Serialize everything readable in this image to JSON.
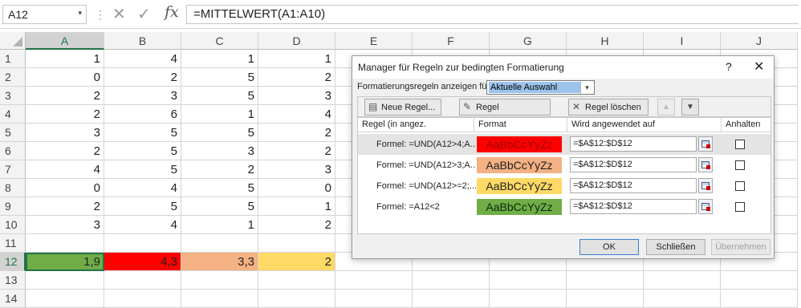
{
  "formula_bar": {
    "name_box": "A12",
    "name_box_dropdown": "▾",
    "separator": "⋮",
    "cancel_icon": "✕",
    "enter_icon": "✓",
    "fx": "fx",
    "formula": "=MITTELWERT(A1:A10)"
  },
  "sheet": {
    "columns": [
      "A",
      "B",
      "C",
      "D",
      "E",
      "F",
      "G",
      "H",
      "I",
      "J"
    ],
    "rows": [
      "1",
      "2",
      "3",
      "4",
      "5",
      "6",
      "7",
      "8",
      "9",
      "10",
      "11",
      "12",
      "13",
      "14"
    ],
    "data": [
      [
        "1",
        "4",
        "1",
        "1"
      ],
      [
        "0",
        "2",
        "5",
        "2"
      ],
      [
        "2",
        "3",
        "5",
        "3"
      ],
      [
        "2",
        "6",
        "1",
        "4"
      ],
      [
        "3",
        "5",
        "5",
        "2"
      ],
      [
        "2",
        "5",
        "3",
        "2"
      ],
      [
        "4",
        "5",
        "2",
        "3"
      ],
      [
        "0",
        "4",
        "5",
        "0"
      ],
      [
        "2",
        "5",
        "5",
        "1"
      ],
      [
        "3",
        "4",
        "1",
        "2"
      ]
    ],
    "result_row": [
      "1,9",
      "4,3",
      "3,3",
      "2"
    ],
    "result_colors": [
      "#70ad47",
      "#ff0000",
      "#f4b183",
      "#ffd966"
    ],
    "active_cell": "A12"
  },
  "dialog": {
    "title": "Manager für Regeln zur bedingten Formatierung",
    "help": "?",
    "close": "✕",
    "show_label": "Formatierungsregeln anzeigen für:",
    "scope_value": "Aktuelle Auswahl",
    "buttons": {
      "new_rule": "Neue Regel...",
      "edit_rule": "Regel bearbeiten...",
      "delete_rule": "Regel löschen",
      "move_up": "▲",
      "move_down": "▼"
    },
    "headers": {
      "rule": "Regel (in angez. Reihenfolge)",
      "format": "Format",
      "applies": "Wird angewendet auf",
      "stop": "Anhalten"
    },
    "rules": [
      {
        "text": "Formel: =UND(A12>4;A...",
        "preview": "AaBbCcYyZz",
        "color": "#ff0000",
        "text_color": "#a00000",
        "applies": "=$A$12:$D$12"
      },
      {
        "text": "Formel: =UND(A12>3;A...",
        "preview": "AaBbCcYyZz",
        "color": "#f4b183",
        "text_color": "#222222",
        "applies": "=$A$12:$D$12"
      },
      {
        "text": "Formel: =UND(A12>=2;...",
        "preview": "AaBbCcYyZz",
        "color": "#ffd966",
        "text_color": "#222222",
        "applies": "=$A$12:$D$12"
      },
      {
        "text": "Formel: =A12<2",
        "preview": "AaBbCcYyZz",
        "color": "#70ad47",
        "text_color": "#0a2a0a",
        "applies": "=$A$12:$D$12"
      }
    ],
    "footer": {
      "ok": "OK",
      "close": "Schließen",
      "apply": "Übernehmen"
    }
  }
}
